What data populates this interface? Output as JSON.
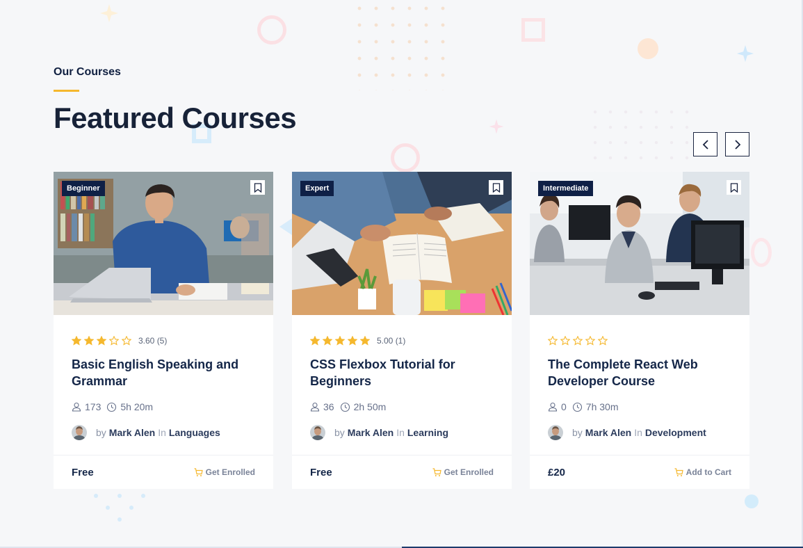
{
  "section": {
    "eyebrow": "Our Courses",
    "heading": "Featured Courses"
  },
  "nav": {
    "prev_icon": "chevron-left-icon",
    "next_icon": "chevron-right-icon"
  },
  "colors": {
    "star": "#f5b82e",
    "badge_bg": "#0f2046",
    "accent_line": "#f5b82e",
    "cart_icon": "#f5b82e"
  },
  "courses": [
    {
      "level": "Beginner",
      "rating_value": 3.6,
      "rating_text": "3.60 (5)",
      "title": "Basic English Speaking and Grammar",
      "students": "173",
      "duration": "5h 20m",
      "by": "by",
      "author": "Mark Alen",
      "in": "In",
      "category": "Languages",
      "price": "Free",
      "cta": "Get Enrolled",
      "image": "man-studying-laptop-library-photo"
    },
    {
      "level": "Expert",
      "rating_value": 5.0,
      "rating_text": "5.00 (1)",
      "title": "CSS Flexbox Tutorial for Beginners",
      "students": "36",
      "duration": "2h 50m",
      "by": "by",
      "author": "Mark Alen",
      "in": "In",
      "category": "Learning",
      "price": "Free",
      "cta": "Get Enrolled",
      "image": "students-books-laptop-desk-photo"
    },
    {
      "level": "Intermediate",
      "rating_value": 0,
      "rating_text": "",
      "title": "The Complete React Web Developer Course",
      "students": "0",
      "duration": "7h 30m",
      "by": "by",
      "author": "Mark Alen",
      "in": "In",
      "category": "Development",
      "price": "£20",
      "cta": "Add to Cart",
      "image": "computer-class-students-photo"
    }
  ]
}
